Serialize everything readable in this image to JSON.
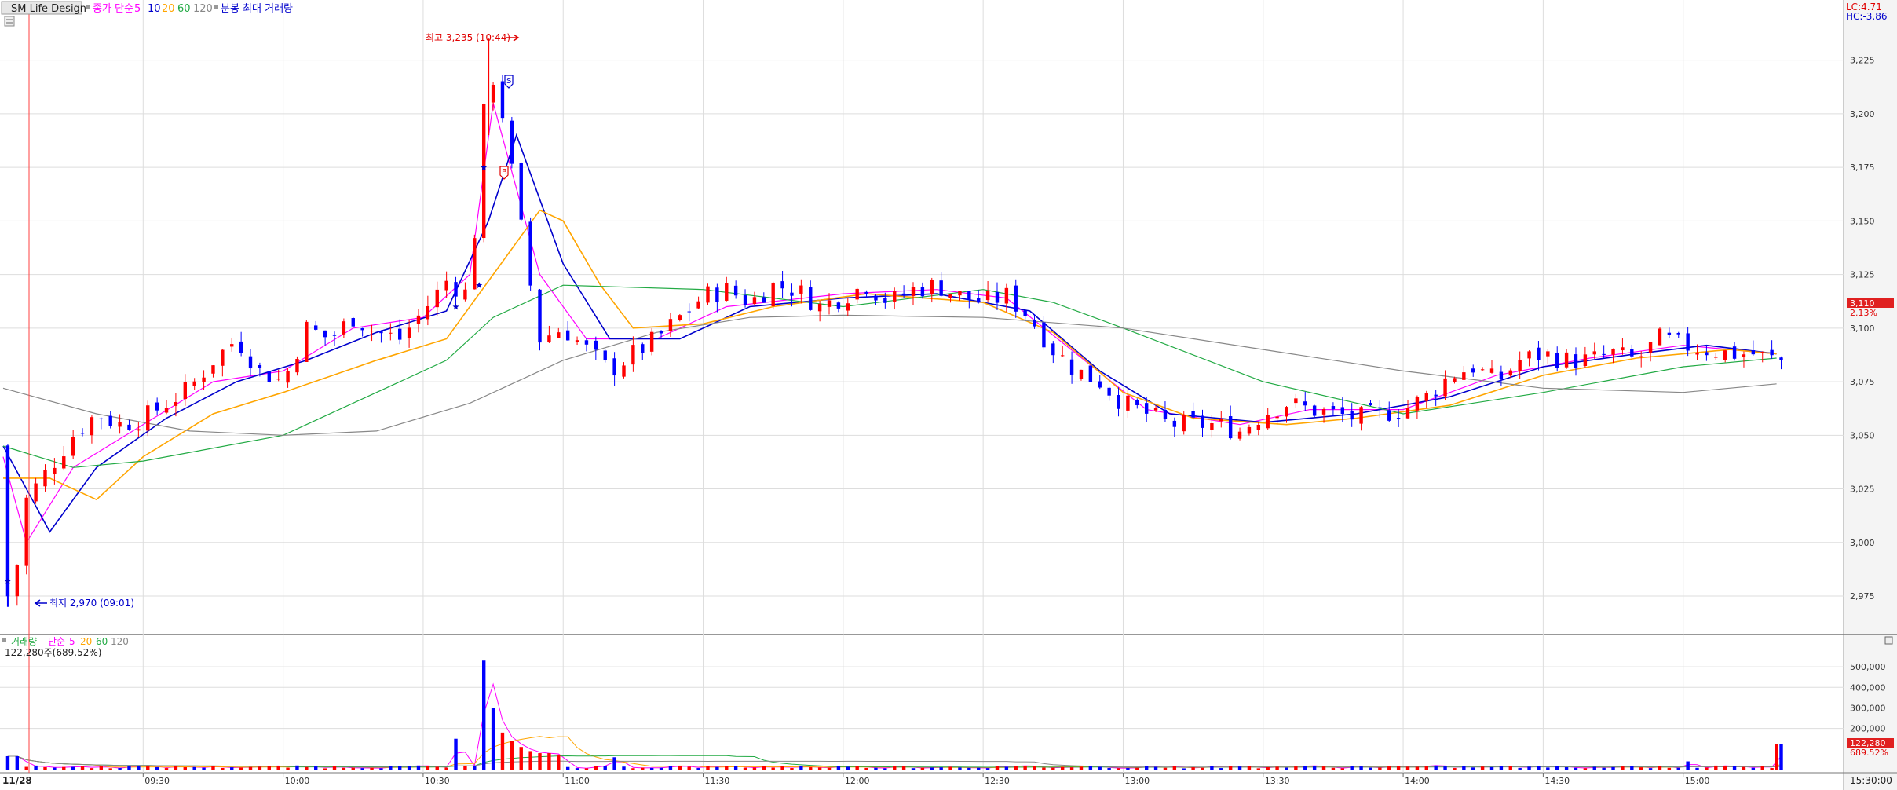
{
  "price_header": {
    "stock_name": "SM Life Design",
    "ma_prefix": "종가 단순",
    "ma_periods": [
      "5",
      "10",
      "20",
      "60",
      "120"
    ],
    "volume_legend_label": "분봉 최대 거래량"
  },
  "volume_header": {
    "label": "거래량",
    "ma_prefix": "단순",
    "ma_periods": [
      "5",
      "20",
      "60",
      "120"
    ],
    "current_text": "122,280주(689.52%)"
  },
  "corner": {
    "lc": "LC:4.71",
    "hc": "HC:-3.86"
  },
  "annotations": {
    "high": "최고 3,235 (10:44)",
    "low": "최저 2,970 (09:01)",
    "sell_marker": "S",
    "buy_marker": "B"
  },
  "current_price": {
    "value": "3,110",
    "pct": "2.13%"
  },
  "current_volume": {
    "value": "122,280",
    "pct": "689.52%"
  },
  "date_label": "11/28",
  "end_time_label": "15:30:00",
  "colors": {
    "up": "#ff0000",
    "down": "#0000ff",
    "ma5": "#ff00ff",
    "ma10": "#0000cc",
    "ma20": "#ffa500",
    "ma60": "#22aa44",
    "ma120": "#888888",
    "grid": "#dddddd",
    "current_badge": "#e02020"
  },
  "chart_data": [
    {
      "type": "candlestick",
      "title": "SM Life Design",
      "ylim": [
        2960,
        3245
      ],
      "y_ticks": [
        "2,975",
        "3,000",
        "3,025",
        "3,050",
        "3,075",
        "3,100",
        "3,125",
        "3,150",
        "3,175",
        "3,200",
        "3,225"
      ],
      "x_ticks": [
        "09:30",
        "10:00",
        "10:30",
        "11:00",
        "11:30",
        "12:00",
        "12:30",
        "13:00",
        "13:30",
        "14:00",
        "14:30",
        "15:00"
      ],
      "price_path": [
        [
          "09:00",
          3045
        ],
        [
          "09:01",
          2975
        ],
        [
          "09:03",
          2990
        ],
        [
          "09:05",
          3020
        ],
        [
          "09:10",
          3035
        ],
        [
          "09:15",
          3050
        ],
        [
          "09:20",
          3060
        ],
        [
          "09:25",
          3055
        ],
        [
          "09:30",
          3058
        ],
        [
          "09:35",
          3065
        ],
        [
          "09:40",
          3072
        ],
        [
          "09:45",
          3085
        ],
        [
          "09:50",
          3095
        ],
        [
          "09:55",
          3080
        ],
        [
          "10:00",
          3075
        ],
        [
          "10:05",
          3100
        ],
        [
          "10:10",
          3095
        ],
        [
          "10:15",
          3105
        ],
        [
          "10:20",
          3098
        ],
        [
          "10:25",
          3095
        ],
        [
          "10:30",
          3108
        ],
        [
          "10:35",
          3122
        ],
        [
          "10:40",
          3115
        ],
        [
          "10:42",
          3175
        ],
        [
          "10:44",
          3225
        ],
        [
          "10:47",
          3200
        ],
        [
          "10:50",
          3160
        ],
        [
          "10:53",
          3120
        ],
        [
          "10:55",
          3095
        ],
        [
          "11:00",
          3100
        ],
        [
          "11:05",
          3090
        ],
        [
          "11:10",
          3080
        ],
        [
          "11:15",
          3088
        ],
        [
          "11:20",
          3095
        ],
        [
          "11:25",
          3105
        ],
        [
          "11:30",
          3115
        ],
        [
          "11:35",
          3118
        ],
        [
          "11:40",
          3112
        ],
        [
          "11:45",
          3120
        ],
        [
          "11:50",
          3118
        ],
        [
          "11:55",
          3110
        ],
        [
          "12:00",
          3115
        ],
        [
          "12:05",
          3120
        ],
        [
          "12:10",
          3112
        ],
        [
          "12:15",
          3118
        ],
        [
          "12:20",
          3120
        ],
        [
          "12:25",
          3115
        ],
        [
          "12:30",
          3112
        ],
        [
          "12:35",
          3115
        ],
        [
          "12:40",
          3105
        ],
        [
          "12:45",
          3090
        ],
        [
          "12:50",
          3080
        ],
        [
          "12:55",
          3075
        ],
        [
          "13:00",
          3065
        ],
        [
          "13:05",
          3060
        ],
        [
          "13:10",
          3055
        ],
        [
          "13:15",
          3055
        ],
        [
          "13:20",
          3055
        ],
        [
          "13:25",
          3052
        ],
        [
          "13:30",
          3060
        ],
        [
          "13:35",
          3065
        ],
        [
          "13:40",
          3062
        ],
        [
          "13:45",
          3060
        ],
        [
          "13:50",
          3058
        ],
        [
          "13:55",
          3060
        ],
        [
          "14:00",
          3062
        ],
        [
          "14:05",
          3068
        ],
        [
          "14:10",
          3078
        ],
        [
          "14:15",
          3082
        ],
        [
          "14:20",
          3075
        ],
        [
          "14:25",
          3085
        ],
        [
          "14:30",
          3088
        ],
        [
          "14:35",
          3085
        ],
        [
          "14:40",
          3085
        ],
        [
          "14:45",
          3088
        ],
        [
          "14:50",
          3085
        ],
        [
          "14:55",
          3095
        ],
        [
          "15:00",
          3092
        ],
        [
          "15:05",
          3090
        ],
        [
          "15:10",
          3088
        ],
        [
          "15:15",
          3088
        ],
        [
          "15:20",
          3085
        ]
      ],
      "ma_series": [
        {
          "name": "5",
          "color": "#ff00ff",
          "values": [
            [
              "09:00",
              3040
            ],
            [
              "09:05",
              3000
            ],
            [
              "09:15",
              3035
            ],
            [
              "09:30",
              3055
            ],
            [
              "09:45",
              3075
            ],
            [
              "10:00",
              3080
            ],
            [
              "10:15",
              3100
            ],
            [
              "10:30",
              3105
            ],
            [
              "10:40",
              3125
            ],
            [
              "10:45",
              3205
            ],
            [
              "10:55",
              3125
            ],
            [
              "11:05",
              3095
            ],
            [
              "11:20",
              3095
            ],
            [
              "11:35",
              3110
            ],
            [
              "12:00",
              3116
            ],
            [
              "12:20",
              3118
            ],
            [
              "12:35",
              3114
            ],
            [
              "12:50",
              3088
            ],
            [
              "13:05",
              3062
            ],
            [
              "13:25",
              3055
            ],
            [
              "13:40",
              3062
            ],
            [
              "14:00",
              3062
            ],
            [
              "14:20",
              3078
            ],
            [
              "14:40",
              3086
            ],
            [
              "15:00",
              3092
            ],
            [
              "15:20",
              3088
            ]
          ]
        },
        {
          "name": "10",
          "color": "#0000cc",
          "values": [
            [
              "09:00",
              3045
            ],
            [
              "09:10",
              3005
            ],
            [
              "09:20",
              3035
            ],
            [
              "09:35",
              3058
            ],
            [
              "09:50",
              3075
            ],
            [
              "10:05",
              3085
            ],
            [
              "10:20",
              3098
            ],
            [
              "10:35",
              3108
            ],
            [
              "10:44",
              3150
            ],
            [
              "10:50",
              3190
            ],
            [
              "11:00",
              3130
            ],
            [
              "11:10",
              3095
            ],
            [
              "11:25",
              3095
            ],
            [
              "11:40",
              3110
            ],
            [
              "12:00",
              3114
            ],
            [
              "12:20",
              3116
            ],
            [
              "12:40",
              3108
            ],
            [
              "12:55",
              3080
            ],
            [
              "13:10",
              3060
            ],
            [
              "13:30",
              3056
            ],
            [
              "13:50",
              3060
            ],
            [
              "14:10",
              3068
            ],
            [
              "14:30",
              3082
            ],
            [
              "14:50",
              3088
            ],
            [
              "15:05",
              3092
            ],
            [
              "15:20",
              3088
            ]
          ]
        },
        {
          "name": "20",
          "color": "#ffa500",
          "values": [
            [
              "09:00",
              3030
            ],
            [
              "09:10",
              3030
            ],
            [
              "09:20",
              3020
            ],
            [
              "09:30",
              3040
            ],
            [
              "09:45",
              3060
            ],
            [
              "10:00",
              3070
            ],
            [
              "10:20",
              3085
            ],
            [
              "10:35",
              3095
            ],
            [
              "10:45",
              3125
            ],
            [
              "10:55",
              3155
            ],
            [
              "11:00",
              3150
            ],
            [
              "11:08",
              3120
            ],
            [
              "11:15",
              3100
            ],
            [
              "11:30",
              3102
            ],
            [
              "11:45",
              3110
            ],
            [
              "12:05",
              3116
            ],
            [
              "12:30",
              3112
            ],
            [
              "12:45",
              3098
            ],
            [
              "13:00",
              3070
            ],
            [
              "13:15",
              3058
            ],
            [
              "13:35",
              3055
            ],
            [
              "13:50",
              3058
            ],
            [
              "14:10",
              3064
            ],
            [
              "14:30",
              3078
            ],
            [
              "14:50",
              3086
            ],
            [
              "15:10",
              3090
            ],
            [
              "15:20",
              3088
            ]
          ]
        },
        {
          "name": "60",
          "color": "#22aa44",
          "values": [
            [
              "09:00",
              3045
            ],
            [
              "09:15",
              3035
            ],
            [
              "09:30",
              3038
            ],
            [
              "10:00",
              3050
            ],
            [
              "10:20",
              3070
            ],
            [
              "10:35",
              3085
            ],
            [
              "10:45",
              3105
            ],
            [
              "11:00",
              3120
            ],
            [
              "11:30",
              3118
            ],
            [
              "12:00",
              3110
            ],
            [
              "12:30",
              3118
            ],
            [
              "12:45",
              3112
            ],
            [
              "13:00",
              3100
            ],
            [
              "13:30",
              3075
            ],
            [
              "14:00",
              3060
            ],
            [
              "14:30",
              3070
            ],
            [
              "15:00",
              3082
            ],
            [
              "15:20",
              3086
            ]
          ]
        },
        {
          "name": "120",
          "color": "#888888",
          "values": [
            [
              "09:00",
              3072
            ],
            [
              "09:20",
              3060
            ],
            [
              "09:40",
              3052
            ],
            [
              "10:00",
              3050
            ],
            [
              "10:20",
              3052
            ],
            [
              "10:40",
              3065
            ],
            [
              "11:00",
              3085
            ],
            [
              "11:20",
              3098
            ],
            [
              "11:40",
              3105
            ],
            [
              "12:00",
              3106
            ],
            [
              "12:30",
              3105
            ],
            [
              "13:00",
              3100
            ],
            [
              "13:30",
              3090
            ],
            [
              "14:00",
              3080
            ],
            [
              "14:30",
              3072
            ],
            [
              "15:00",
              3070
            ],
            [
              "15:20",
              3074
            ]
          ]
        }
      ]
    },
    {
      "type": "bar",
      "title": "거래량",
      "ylim": [
        0,
        550000
      ],
      "y_ticks": [
        "200,000",
        "300,000",
        "400,000",
        "500,000"
      ],
      "spikes": [
        [
          "09:01",
          65000
        ],
        [
          "10:36",
          150000
        ],
        [
          "10:43",
          530000
        ],
        [
          "10:44",
          240000
        ],
        [
          "10:45",
          300000
        ],
        [
          "10:46",
          250000
        ],
        [
          "10:47",
          180000
        ],
        [
          "10:48",
          140000
        ],
        [
          "10:50",
          110000
        ],
        [
          "10:52",
          90000
        ],
        [
          "10:55",
          80000
        ],
        [
          "11:10",
          60000
        ],
        [
          "15:00",
          40000
        ],
        [
          "15:20",
          122280
        ]
      ]
    }
  ]
}
